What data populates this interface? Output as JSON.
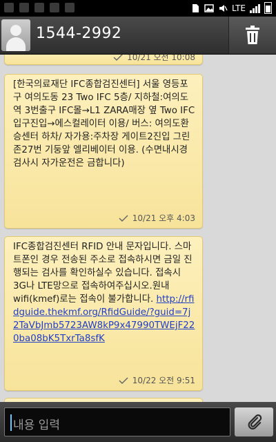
{
  "status_bar": {
    "network": "LTE",
    "icons": [
      "notification-icon",
      "notification-icon",
      "notification-icon",
      "notification-icon",
      "notification-icon",
      "sd-card-icon",
      "image-icon",
      "mute-icon",
      "signal-icon",
      "battery-icon"
    ]
  },
  "header": {
    "title": "1544-2992",
    "delete_icon": "trash-icon"
  },
  "messages": [
    {
      "text": "",
      "time": "10/21 오전 10:08"
    },
    {
      "text": "[한국의료재단 IFC종합검진센터] 서울 영등포구 여의도동 23 Two IFC 5층/ 지하철:여의도역 3번출구 IFC몰→L1 ZARA매장 옆 Two IFC 입구진입→에스컬레이터 이용/ 버스: 여의도환승센터 하차/ 자가용:주차장 게이트2진입 그린존27번 기둥앞 엘리베이터 이용. (수면내시경 검사시 자가운전은 금합니다)",
      "time": "10/21 오후 4:03"
    },
    {
      "text": "IFC종합검진센터 RFID 안내 문자입니다. 스마트폰인 경우 전송된 주소로 접속하시면 금일 진행되는 검사를 확인하실수 있습니다. 접속시 3G나 LTE망으로 접속하여주십시오.원내 wifi(kmef)로는 접속이 불가합니다. ",
      "link": "http://rfidguide.thekmf.org/RfidGuide/?guid=7j2TaVbJmb5723AW8kP9x47990TWEjF220ba08bK5TxrTa8sfK",
      "time": "10/22 오전 9:51"
    }
  ],
  "input": {
    "placeholder": "내용 입력"
  },
  "attach_icon": "paperclip-icon"
}
